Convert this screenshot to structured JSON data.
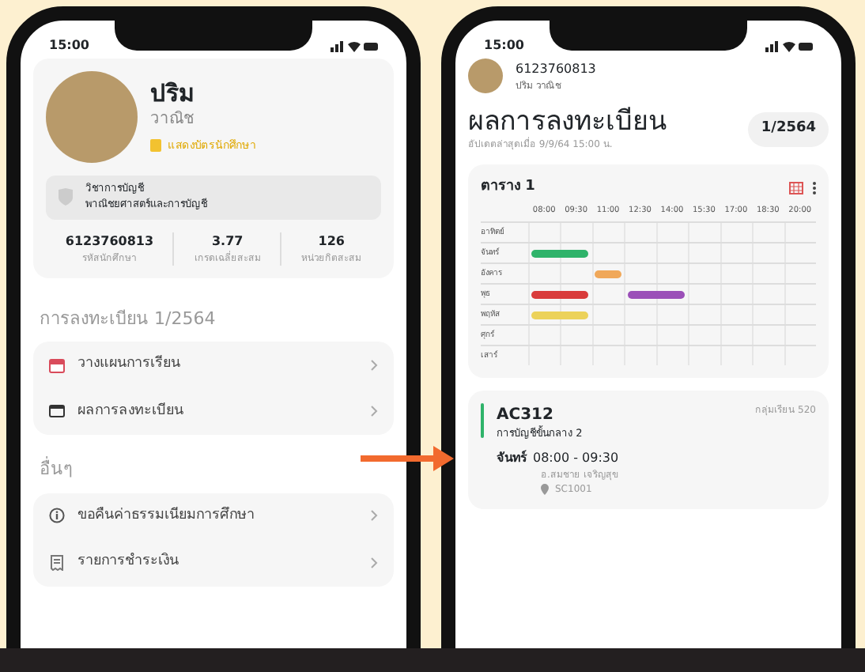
{
  "left_phone": {
    "status_time": "15:00",
    "profile": {
      "first_name": "ปริม",
      "last_name": "วาณิช",
      "card_link": "แสดงบัตรนักศึกษา",
      "major": "วิชาการบัญชี",
      "faculty": "พาณิชยศาสตร์และการบัญชี",
      "stats": [
        {
          "value": "6123760813",
          "label": "รหัสนักศึกษา"
        },
        {
          "value": "3.77",
          "label": "เกรดเฉลี่ยสะสม"
        },
        {
          "value": "126",
          "label": "หน่วยกิตสะสม"
        }
      ]
    },
    "sections": [
      {
        "title": "การลงทะเบียน 1/2564",
        "items": [
          {
            "kind": "calendar",
            "label": "วางแผนการเรียน"
          },
          {
            "kind": "card",
            "label": "ผลการลงทะเบียน"
          }
        ]
      },
      {
        "title": "อื่นๆ",
        "items": [
          {
            "kind": "info",
            "label": "ขอคืนค่าธรรมเนียมการศึกษา"
          },
          {
            "kind": "receipt",
            "label": "รายการชำระเงิน"
          }
        ]
      }
    ]
  },
  "right_phone": {
    "status_time": "15:00",
    "student_id": "6123760813",
    "student_name": "ปริม วาณิช",
    "title": "ผลการลงทะเบียน",
    "term": "1/2564",
    "updated": "อัปเดตล่าสุดเมื่อ 9/9/64 15:00 น.",
    "timetable": {
      "title": "ตาราง 1",
      "times": [
        "08:00",
        "09:30",
        "11:00",
        "12:30",
        "14:00",
        "15:30",
        "17:00",
        "18:30",
        "20:00"
      ],
      "days": [
        {
          "label": "อาทิตย์"
        },
        {
          "label": "จันทร์",
          "slots": [
            {
              "filled": true,
              "color": "#2fb36a"
            },
            {
              "filled": true,
              "color": "#2fb36a"
            },
            {
              "filled": false
            },
            {
              "filled": false
            },
            {
              "filled": false
            },
            {
              "filled": false
            },
            {
              "filled": false
            },
            {
              "filled": false
            },
            {
              "filled": false
            }
          ]
        },
        {
          "label": "อังคาร",
          "slots": [
            {
              "filled": false
            },
            {
              "filled": false
            },
            {
              "filled": true,
              "color": "#f0a85a"
            },
            {
              "filled": false
            },
            {
              "filled": false
            },
            {
              "filled": false
            },
            {
              "filled": false
            },
            {
              "filled": false
            },
            {
              "filled": false
            }
          ]
        },
        {
          "label": "พุธ",
          "slots": [
            {
              "filled": true,
              "color": "#d93b3b"
            },
            {
              "filled": true,
              "color": "#d93b3b"
            },
            {
              "filled": false
            },
            {
              "filled": true,
              "color": "#9b4fb8"
            },
            {
              "filled": true,
              "color": "#9b4fb8"
            },
            {
              "filled": false
            },
            {
              "filled": false
            },
            {
              "filled": false
            },
            {
              "filled": false
            }
          ]
        },
        {
          "label": "พฤหัส",
          "slots": [
            {
              "filled": true,
              "color": "#ecd25a"
            },
            {
              "filled": true,
              "color": "#ecd25a"
            },
            {
              "filled": false
            },
            {
              "filled": false
            },
            {
              "filled": false
            },
            {
              "filled": false
            },
            {
              "filled": false
            },
            {
              "filled": false
            },
            {
              "filled": false
            }
          ]
        },
        {
          "label": "ศุกร์"
        },
        {
          "label": "เสาร์"
        }
      ]
    },
    "courses": [
      {
        "code": "AC312",
        "name": "การบัญชีขั้นกลาง 2",
        "section": "กลุ่มเรียน 520",
        "day": "จันทร์",
        "time": "08:00 - 09:30",
        "teacher": "อ.สมชาย เจริญสุข",
        "room": "SC1001",
        "color": "#2fb36a"
      }
    ]
  }
}
